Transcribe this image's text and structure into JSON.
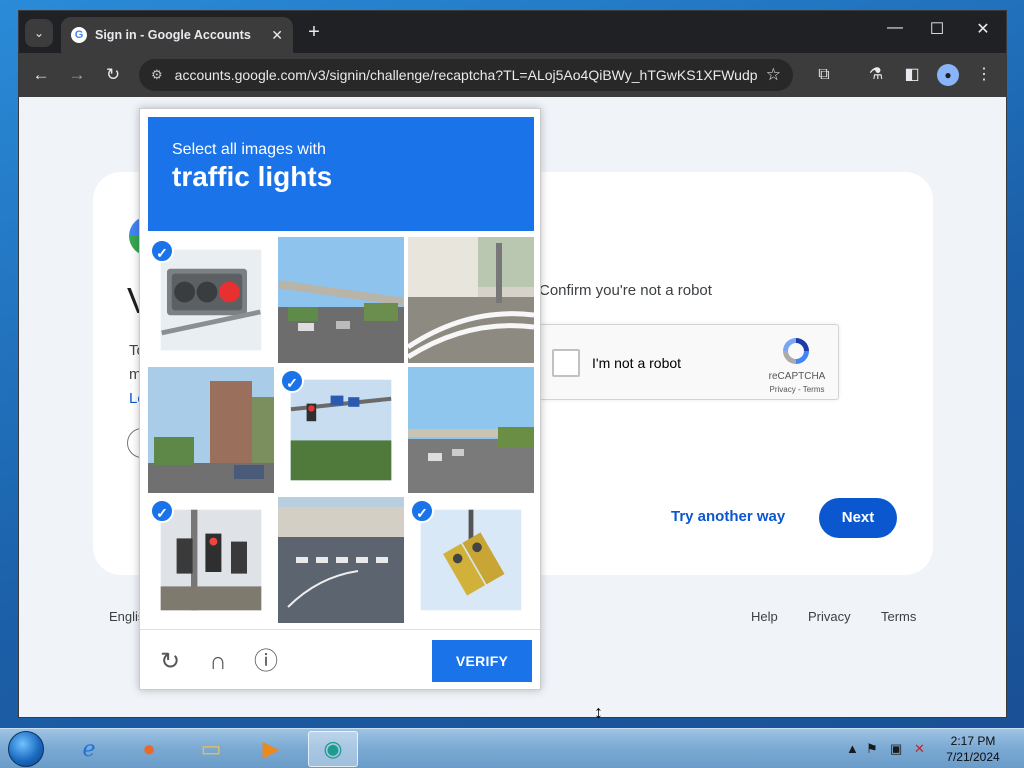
{
  "browser": {
    "tab_title": "Sign in - Google Accounts",
    "url": "accounts.google.com/v3/signin/challenge/recaptcha?TL=ALoj5Ao4QiBWy_hTGwKS1XFWudp..."
  },
  "signin": {
    "heading_fragment": "V",
    "text_fragment_1": "To",
    "text_fragment_2": "m",
    "link_fragment": "Le",
    "confirm_text": "Confirm you're not a robot",
    "checkbox_label": "I'm not a robot",
    "recaptcha_brand": "reCAPTCHA",
    "recaptcha_links": "Privacy - Terms",
    "try_another": "Try another way",
    "next_label": "Next"
  },
  "footer": {
    "language": "Englis",
    "help": "Help",
    "privacy": "Privacy",
    "terms": "Terms"
  },
  "challenge": {
    "prompt": "Select all images with",
    "target": "traffic lights",
    "verify_label": "VERIFY",
    "tiles": [
      {
        "selected": true
      },
      {
        "selected": false
      },
      {
        "selected": false
      },
      {
        "selected": false
      },
      {
        "selected": true
      },
      {
        "selected": false
      },
      {
        "selected": true
      },
      {
        "selected": false
      },
      {
        "selected": true
      }
    ]
  },
  "taskbar": {
    "time": "2:17 PM",
    "date": "7/21/2024"
  },
  "colors": {
    "recaptcha_blue": "#1a73e8",
    "google_blue": "#0b57d0"
  }
}
